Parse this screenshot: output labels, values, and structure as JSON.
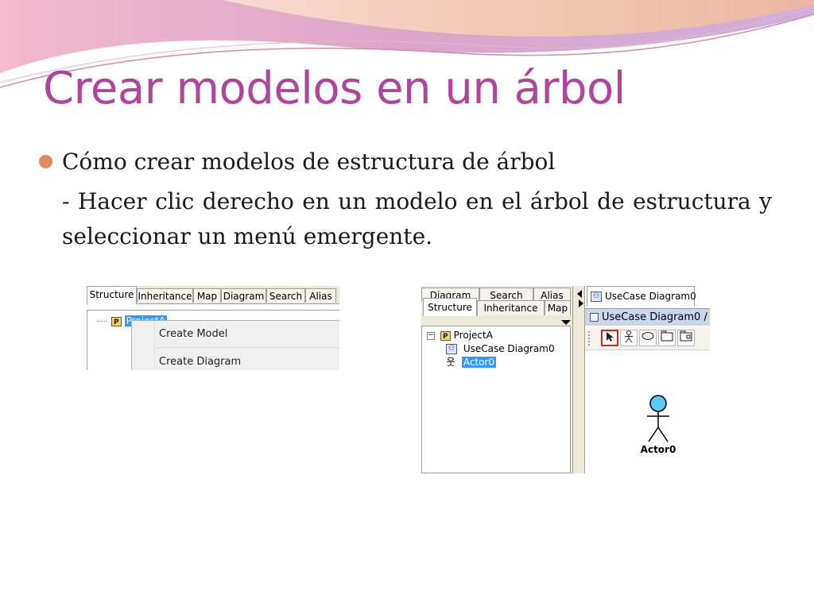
{
  "slide": {
    "title": "Crear modelos en un árbol",
    "bullet": "Cómo crear modelos de estructura de árbol",
    "sub_text": "- Hacer clic derecho en un modelo en el árbol de estructura y seleccionar un menú emergente.",
    "colors": {
      "title": "#b0449f",
      "bullet": "#e5895b",
      "wave_pink": "#e7a0b8",
      "wave_peach": "#f6c9a8"
    }
  },
  "screenshot1": {
    "tabs": [
      "Structure",
      "Inheritance",
      "Map",
      "Diagram",
      "Search",
      "Alias"
    ],
    "active_tab": "Structure",
    "tree_node": "ProjectA",
    "tree_node_icon": "P",
    "menu_items": [
      "Create Model",
      "Create Diagram"
    ]
  },
  "screenshot2": {
    "tabs_row1": [
      "Diagram",
      "Search",
      "Alias"
    ],
    "tabs_row2": [
      "Structure",
      "Inheritance",
      "Map"
    ],
    "active_tab": "Structure",
    "tree": {
      "root": "ProjectA",
      "root_icon": "P",
      "root_expander": "−",
      "children": [
        "UseCase Diagram0",
        "Actor0"
      ]
    },
    "doc_tab": "UseCase Diagram0",
    "diagram_header": "UseCase Diagram0 / ",
    "tools": [
      "select-tool",
      "actor-tool",
      "usecase-tool",
      "package-tool",
      "subsystem-tool"
    ],
    "actor_label": "Actor0",
    "actor_color": "#5bc8f5",
    "active_tool_color": "#e02020"
  }
}
